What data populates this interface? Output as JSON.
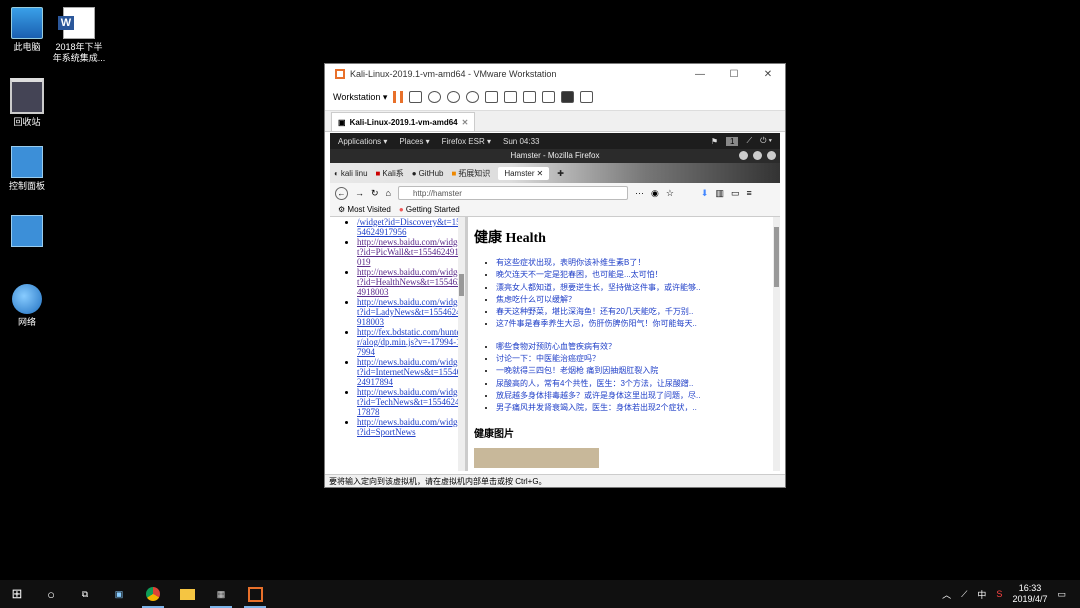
{
  "desktop": {
    "icons": [
      {
        "label": "此电脑",
        "icon": "computer-icon"
      },
      {
        "label": "2018年下半年系统集成...",
        "icon": "word-document-icon"
      },
      {
        "label": "回收站",
        "icon": "recycle-bin-icon"
      },
      {
        "label": "控制面板",
        "icon": "control-panel-icon"
      },
      {
        "label": "",
        "icon": "control-panel-icon"
      },
      {
        "label": "网络",
        "icon": "network-icon"
      }
    ]
  },
  "vmware": {
    "title": "Kali-Linux-2019.1-vm-amd64 - VMware Workstation",
    "toolbar_menu": "Workstation ▾",
    "tab_label": "Kali-Linux-2019.1-vm-amd64",
    "status_text": "要将输入定向到该虚拟机，请在虚拟机内部单击或按 Ctrl+G。"
  },
  "gnome": {
    "applications": "Applications ▾",
    "places": "Places ▾",
    "firefox": "Firefox ESR ▾",
    "clock": "Sun 04:33",
    "workspace": "1"
  },
  "firefox": {
    "window_title": "Hamster - Mozilla Firefox",
    "tabs": [
      "kali linu",
      "Kali系",
      "GitHub",
      "拓展知识",
      "Hamster"
    ],
    "url": "http://hamster",
    "bookmarks": [
      "Most Visited",
      "Getting Started"
    ]
  },
  "left_links": [
    {
      "text": "/widget?id=Discovery&t=1554624917956",
      "visited": false
    },
    {
      "text": "http://news.baidu.com/widget?id=PicWall&t=1554624918019",
      "visited": true
    },
    {
      "text": "http://news.baidu.com/widget?id=HealthNews&t=1554624918003",
      "visited": true
    },
    {
      "text": "http://news.baidu.com/widget?id=LadyNews&t=1554624918003",
      "visited": false
    },
    {
      "text": "http://fex.bdstatic.com/hunter/alog/dp.min.js?v=-17994-17994",
      "visited": false
    },
    {
      "text": "http://news.baidu.com/widget?id=InternetNews&t=1554624917894",
      "visited": false
    },
    {
      "text": "http://news.baidu.com/widget?id=TechNews&t=1554624917878",
      "visited": false
    },
    {
      "text": "http://news.baidu.com/widget?id=SportNews",
      "visited": false
    }
  ],
  "page": {
    "heading": "健康  Health",
    "list1": [
      "有这些症状出现，表明你该补维生素B了！",
      "晚欠连天不一定是犯春困，也可能是...太可怕！",
      "漂亮女人都知道，想要逆生长，坚持做这件事，或许能够..",
      "焦虑吃什么可以缓解？",
      "春天这种野菜，堪比深海鱼！还有20几天能吃，千万别..",
      "这7件事是春季养生大忌，伤肝伤脾伤阳气！你可能每天.."
    ],
    "list2": [
      "哪些食物对预防心血管疾病有效？",
      "讨论一下：中医能治癌症吗？",
      "一晚就得三四包！老烟枪 痛到因抽烟肛裂入院",
      "尿酸高的人，常有4个共性，医生：3个方法，让尿酸蹭..",
      "放屁越多身体排毒越多？或许是身体这里出现了问题，尽..",
      "男子痛风并发肾衰竭入院，医生：身体若出现2个症状，.."
    ],
    "subheading": "健康图片"
  },
  "taskbar": {
    "clock_time": "16:33",
    "clock_date": "2019/4/7",
    "ime": "中"
  }
}
